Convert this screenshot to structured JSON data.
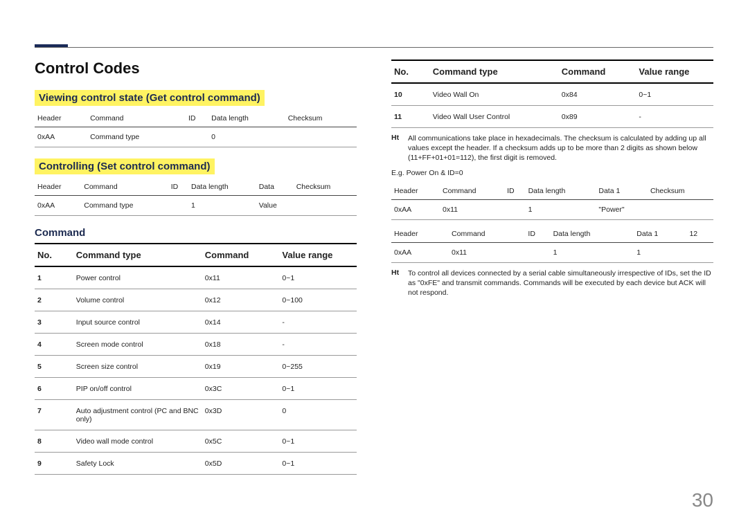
{
  "page_number": "30",
  "title": "Control Codes",
  "left": {
    "section1_title": "Viewing control state (Get control command)",
    "table1": {
      "headers": [
        "Header",
        "Command",
        "ID",
        "Data length",
        "Checksum"
      ],
      "row": [
        "0xAA",
        "Command type",
        "",
        "0",
        ""
      ]
    },
    "section2_title": "Controlling (Set control command)",
    "table2": {
      "headers": [
        "Header",
        "Command",
        "ID",
        "Data length",
        "Data",
        "Checksum"
      ],
      "row": [
        "0xAA",
        "Command type",
        "",
        "1",
        "Value",
        ""
      ]
    },
    "section3_title": "Command",
    "cmd_headers": {
      "no": "No.",
      "type": "Command type",
      "cmd": "Command",
      "range": "Value range"
    },
    "cmds": [
      {
        "no": "1",
        "type": "Power control",
        "cmd": "0x11",
        "range": "0~1"
      },
      {
        "no": "2",
        "type": "Volume control",
        "cmd": "0x12",
        "range": "0~100"
      },
      {
        "no": "3",
        "type": "Input source control",
        "cmd": "0x14",
        "range": "-"
      },
      {
        "no": "4",
        "type": "Screen mode control",
        "cmd": "0x18",
        "range": "-"
      },
      {
        "no": "5",
        "type": "Screen size control",
        "cmd": "0x19",
        "range": "0~255"
      },
      {
        "no": "6",
        "type": "PIP on/off control",
        "cmd": "0x3C",
        "range": "0~1"
      },
      {
        "no": "7",
        "type": "Auto adjustment control (PC and BNC only)",
        "cmd": "0x3D",
        "range": "0"
      },
      {
        "no": "8",
        "type": "Video wall mode control",
        "cmd": "0x5C",
        "range": "0~1"
      },
      {
        "no": "9",
        "type": "Safety Lock",
        "cmd": "0x5D",
        "range": "0~1"
      }
    ]
  },
  "right": {
    "cmd_headers": {
      "no": "No.",
      "type": "Command type",
      "cmd": "Command",
      "range": "Value range"
    },
    "cmds": [
      {
        "no": "10",
        "type": "Video Wall On",
        "cmd": "0x84",
        "range": "0~1"
      },
      {
        "no": "11",
        "type": "Video Wall User Control",
        "cmd": "0x89",
        "range": "-"
      }
    ],
    "note1_label": "Ht",
    "note1_text": "All communications take place in hexadecimals. The checksum is calculated by adding up all values except the header. If a checksum adds up to be more than 2 digits as shown below (11+FF+01+01=112), the first digit is removed.",
    "eg_line": "E.g. Power On & ID=0",
    "tableA": {
      "headers": [
        "Header",
        "Command",
        "ID",
        "Data length",
        "Data 1",
        "Checksum"
      ],
      "row": [
        "0xAA",
        "0x11",
        "",
        "1",
        "\"Power\"",
        ""
      ]
    },
    "tableB": {
      "headers": [
        "Header",
        "Command",
        "ID",
        "Data length",
        "Data 1",
        "12"
      ],
      "row": [
        "0xAA",
        "0x11",
        "",
        "1",
        "1",
        ""
      ]
    },
    "note2_label": "Ht",
    "note2_text": "To control all devices connected by a serial cable simultaneously irrespective of IDs, set the ID as \"0xFE\" and transmit commands. Commands will be executed by each device but ACK will not respond."
  }
}
